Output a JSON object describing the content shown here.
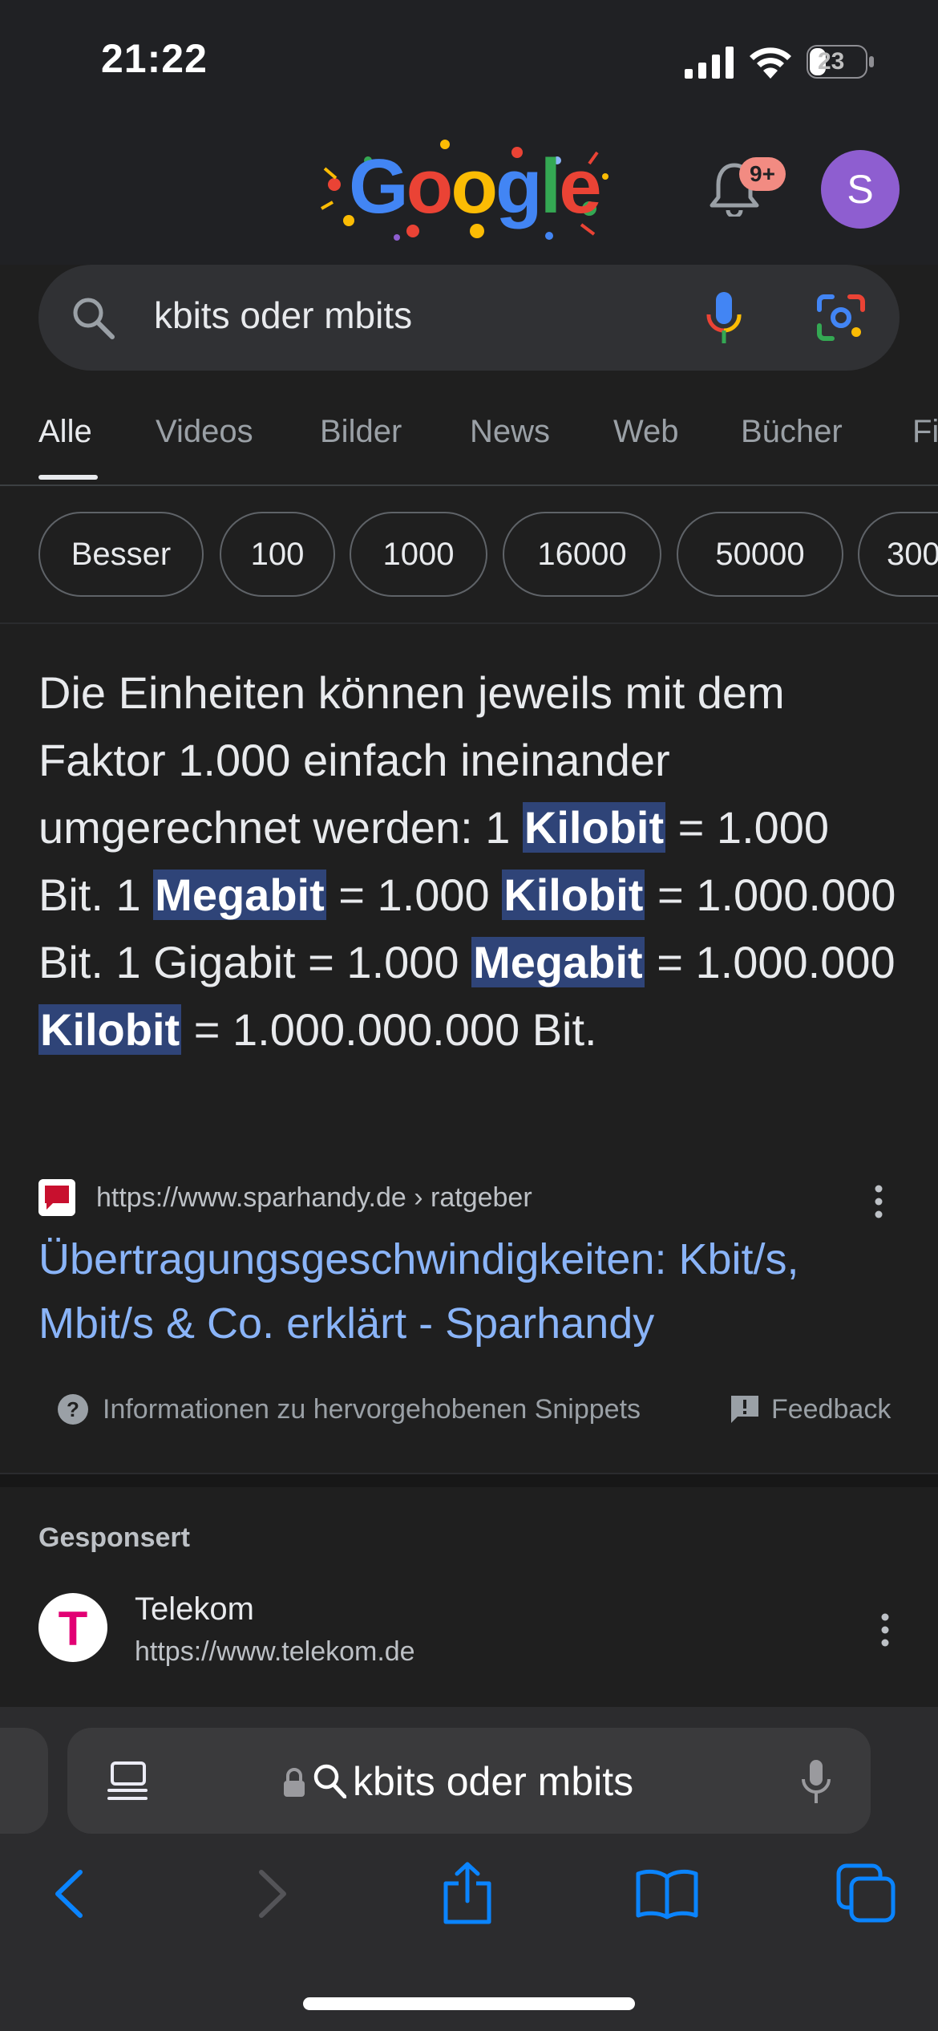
{
  "status_bar": {
    "time": "21:22",
    "battery": "23"
  },
  "header": {
    "logo_letters": [
      "G",
      "o",
      "o",
      "g",
      "l",
      "e"
    ],
    "notification_badge": "9+",
    "avatar_initial": "S"
  },
  "search": {
    "query": "kbits oder mbits"
  },
  "tabs": [
    {
      "label": "Alle",
      "active": true
    },
    {
      "label": "Videos"
    },
    {
      "label": "Bilder"
    },
    {
      "label": "News"
    },
    {
      "label": "Web"
    },
    {
      "label": "Bücher"
    },
    {
      "label": "Fi"
    }
  ],
  "chips": [
    "Besser",
    "100",
    "1000",
    "16000",
    "50000",
    "300"
  ],
  "snippet": {
    "parts": [
      {
        "t": "Die Einheiten können jeweils mit dem Faktor 1.000 einfach ineinander umgerechnet werden: 1 "
      },
      {
        "t": "Kilobit",
        "hl": true
      },
      {
        "t": " = 1.000 Bit. 1 "
      },
      {
        "t": "Megabit",
        "hl": true
      },
      {
        "t": " = 1.000 "
      },
      {
        "t": "Kilobit",
        "hl": true
      },
      {
        "t": " = 1.000.000 Bit. 1 Gigabit = 1.000 "
      },
      {
        "t": "Megabit",
        "hl": true
      },
      {
        "t": " = 1.000.000 "
      },
      {
        "t": "Kilobit",
        "hl": true
      },
      {
        "t": " = 1.000.000.000 Bit."
      }
    ],
    "source_url": "https://www.sparhandy.de › ratgeber",
    "title": "Übertragungsgeschwindigkeiten: Kbit/s, Mbit/s & Co. erklärt - Sparhandy",
    "info_label": "Informationen zu hervorgehobenen Snippets",
    "feedback_label": "Feedback"
  },
  "sponsored": {
    "label": "Gesponsert",
    "advertiser": "Telekom",
    "url": "https://www.telekom.de",
    "logo_letter": "T"
  },
  "browser": {
    "address_text": "kbits oder mbits"
  },
  "colors": {
    "link": "#8ab4f8",
    "highlight": "#2f4478",
    "ios_blue": "#0a84ff",
    "telekom_magenta": "#e20074"
  },
  "icons": [
    "search-icon",
    "mic-icon",
    "lens-icon",
    "bell-icon",
    "info-icon",
    "feedback-icon",
    "reader-icon",
    "lock-icon",
    "back-icon",
    "forward-icon",
    "share-icon",
    "bookmarks-icon",
    "tabs-icon"
  ]
}
